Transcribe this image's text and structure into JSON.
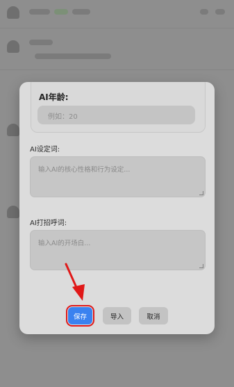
{
  "background": {
    "rows": [
      {
        "name": "bg-row-1"
      },
      {
        "name": "bg-row-2"
      },
      {
        "name": "bg-row-3"
      },
      {
        "name": "bg-row-4"
      }
    ]
  },
  "modal": {
    "age": {
      "label": "AI年龄:",
      "placeholder": "例如：20"
    },
    "setting": {
      "label": "AI设定词:",
      "placeholder": "输入AI的核心性格和行为设定..."
    },
    "greeting": {
      "label": "AI打招呼词:",
      "placeholder": "输入AI的开场白..."
    },
    "buttons": {
      "save": "保存",
      "import": "导入",
      "cancel": "取消"
    }
  },
  "colors": {
    "overlay": "#8e8e8e",
    "modal_bg": "#dcdcdc",
    "primary": "#3a82f0",
    "highlight": "#e01818"
  }
}
